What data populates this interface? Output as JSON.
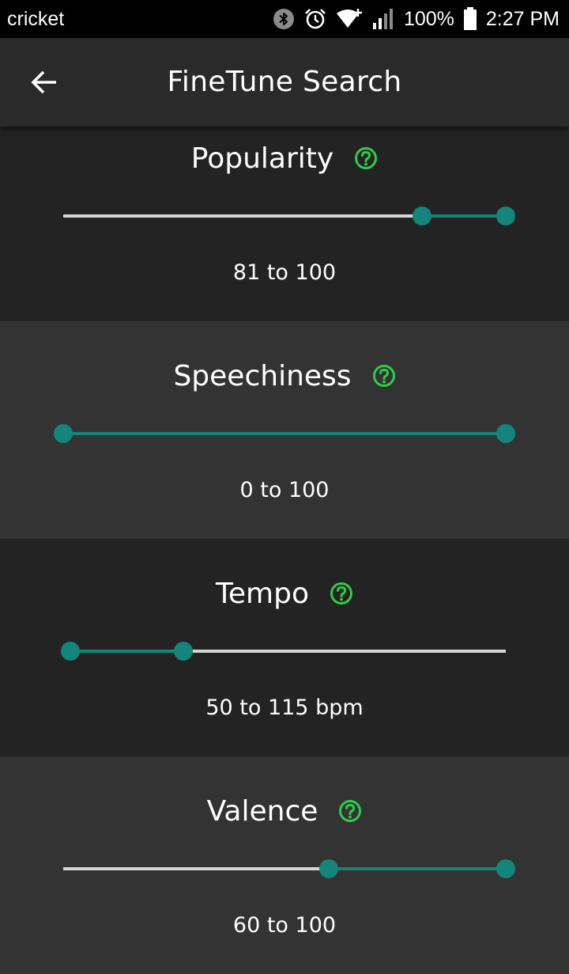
{
  "status_bar": {
    "carrier": "cricket",
    "battery": "100%",
    "time": "2:27 PM",
    "icons": [
      "bluetooth-icon",
      "alarm-icon",
      "wifi-icon",
      "signal-icon",
      "battery-icon"
    ]
  },
  "app_bar": {
    "title": "FineTune Search",
    "back_icon": "arrow-left-icon"
  },
  "colors": {
    "accent": "#13857a",
    "help": "#2ecc4a",
    "track": "#d4d4d4",
    "bg_dark": "#232323",
    "bg_light": "#333333"
  },
  "sliders": [
    {
      "label": "Popularity",
      "min": 0,
      "max": 100,
      "low": 81,
      "high": 100,
      "value_text": "81 to 100"
    },
    {
      "label": "Speechiness",
      "min": 0,
      "max": 100,
      "low": 0,
      "high": 100,
      "value_text": "0 to 100"
    },
    {
      "label": "Tempo",
      "min": 46,
      "max": 300,
      "low": 50,
      "high": 115,
      "value_text": "50 to 115 bpm"
    },
    {
      "label": "Valence",
      "min": 0,
      "max": 100,
      "low": 60,
      "high": 100,
      "value_text": "60 to 100"
    }
  ]
}
